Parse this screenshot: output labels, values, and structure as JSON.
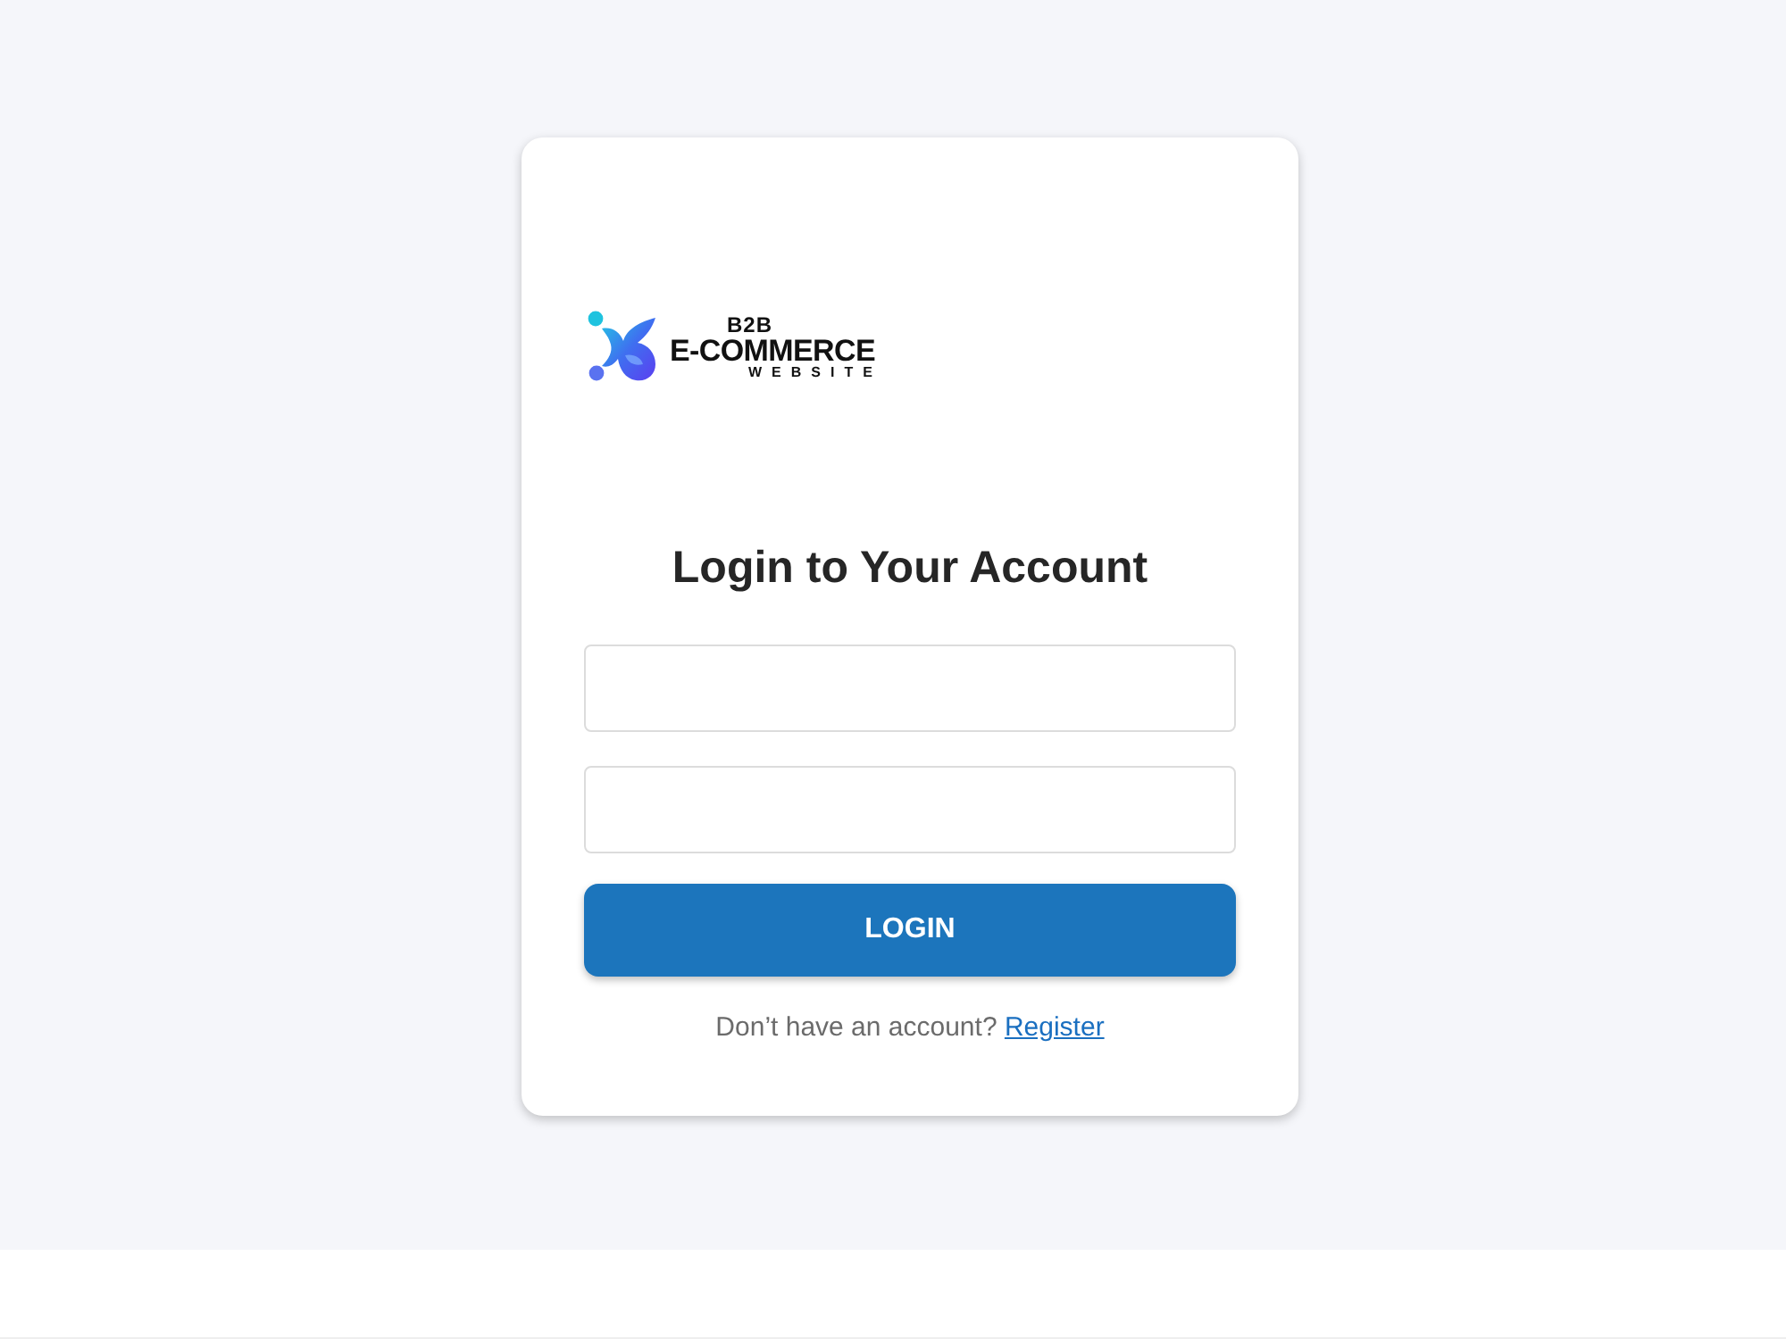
{
  "logo": {
    "top_line": "B2B",
    "main_line": "E-COMMERCE",
    "bottom_line": "WEBSITE"
  },
  "title": "Login to Your Account",
  "fields": [
    {
      "kind": "input"
    },
    {
      "kind": "input"
    }
  ],
  "button": {
    "label": "LOGIN"
  },
  "footer": {
    "question": "Don’t have an account?",
    "link": "Register"
  }
}
